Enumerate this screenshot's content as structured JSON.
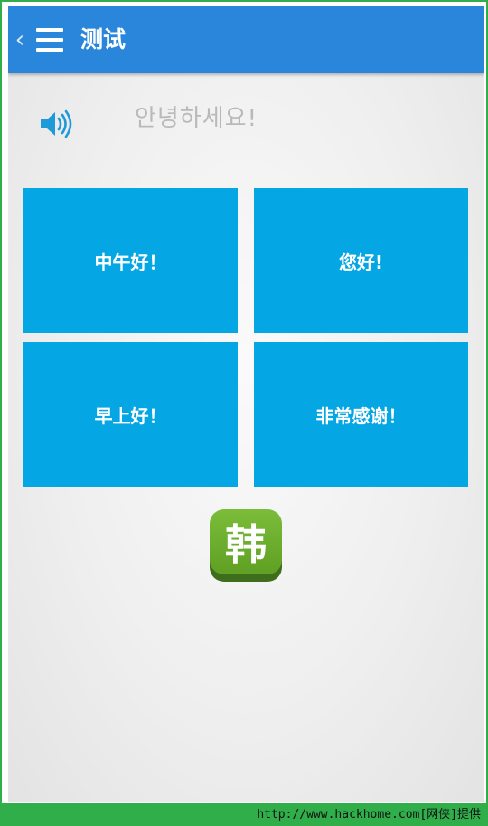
{
  "appbar": {
    "back_icon": "chevron-left-icon",
    "menu_icon": "hamburger-menu-icon",
    "title": "测试",
    "color": "#2a86db"
  },
  "question": {
    "speaker_icon": "speaker-volume-icon",
    "text": "안녕하세요!"
  },
  "options": [
    {
      "label": "中午好！"
    },
    {
      "label": "您好!"
    },
    {
      "label": "早上好！"
    },
    {
      "label": "非常感谢！"
    }
  ],
  "option_color": "#05a6e4",
  "logo": {
    "text": "韩",
    "color": "#6aad2c"
  },
  "footer": {
    "text": "http://www.hackhome.com[网侠]提供",
    "color": "#2fae4a"
  }
}
